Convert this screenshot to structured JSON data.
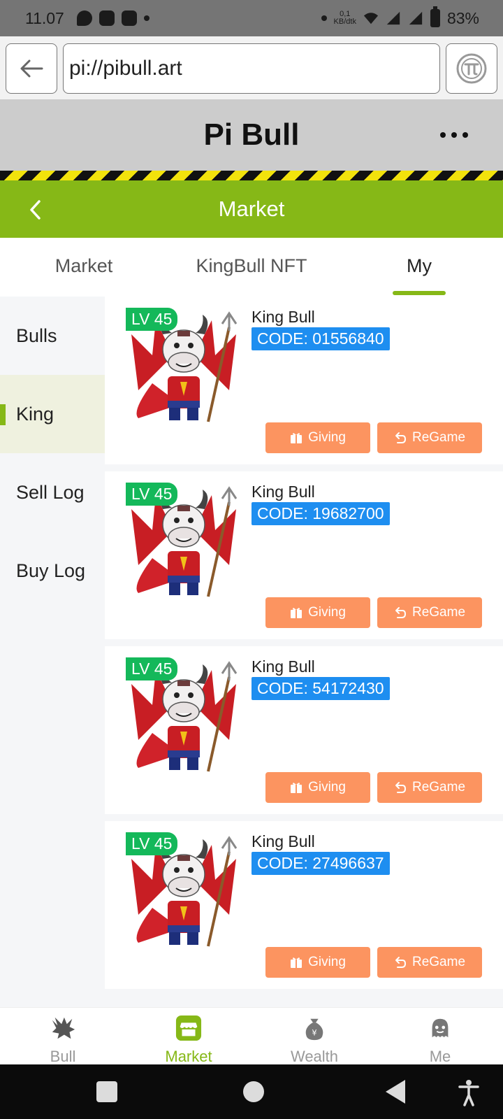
{
  "status_bar": {
    "time": "11.07",
    "net_speed_value": "0,1",
    "net_speed_unit": "KB/dtk",
    "battery": "83%"
  },
  "browser": {
    "url": "pi://pibull.art"
  },
  "app": {
    "title": "Pi Bull"
  },
  "page_header": {
    "title": "Market"
  },
  "tabs": [
    {
      "label": "Market"
    },
    {
      "label": "KingBull NFT"
    },
    {
      "label": "My"
    }
  ],
  "selected_tab": "My",
  "side_menu": [
    {
      "label": "Bulls"
    },
    {
      "label": "King"
    },
    {
      "label": "Sell Log"
    },
    {
      "label": "Buy Log"
    }
  ],
  "selected_side_item": "King",
  "cards": [
    {
      "level": "LV 45",
      "name": "King Bull",
      "code": "CODE: 01556840",
      "giving_label": "Giving",
      "regame_label": "ReGame"
    },
    {
      "level": "LV 45",
      "name": "King Bull",
      "code": "CODE: 19682700",
      "giving_label": "Giving",
      "regame_label": "ReGame"
    },
    {
      "level": "LV 45",
      "name": "King Bull",
      "code": "CODE: 54172430",
      "giving_label": "Giving",
      "regame_label": "ReGame"
    },
    {
      "level": "LV 45",
      "name": "King Bull",
      "code": "CODE: 27496637",
      "giving_label": "Giving",
      "regame_label": "ReGame"
    }
  ],
  "bottom_nav": [
    {
      "label": "Bull",
      "icon": "bull-icon"
    },
    {
      "label": "Market",
      "icon": "market-icon"
    },
    {
      "label": "Wealth",
      "icon": "money-bag-icon"
    },
    {
      "label": "Me",
      "icon": "user-icon"
    }
  ],
  "selected_nav": "Market",
  "colors": {
    "accent_green": "#86b817",
    "level_badge": "#14b85a",
    "code_badge": "#1e8ef0",
    "button_orange": "#fc9460"
  }
}
